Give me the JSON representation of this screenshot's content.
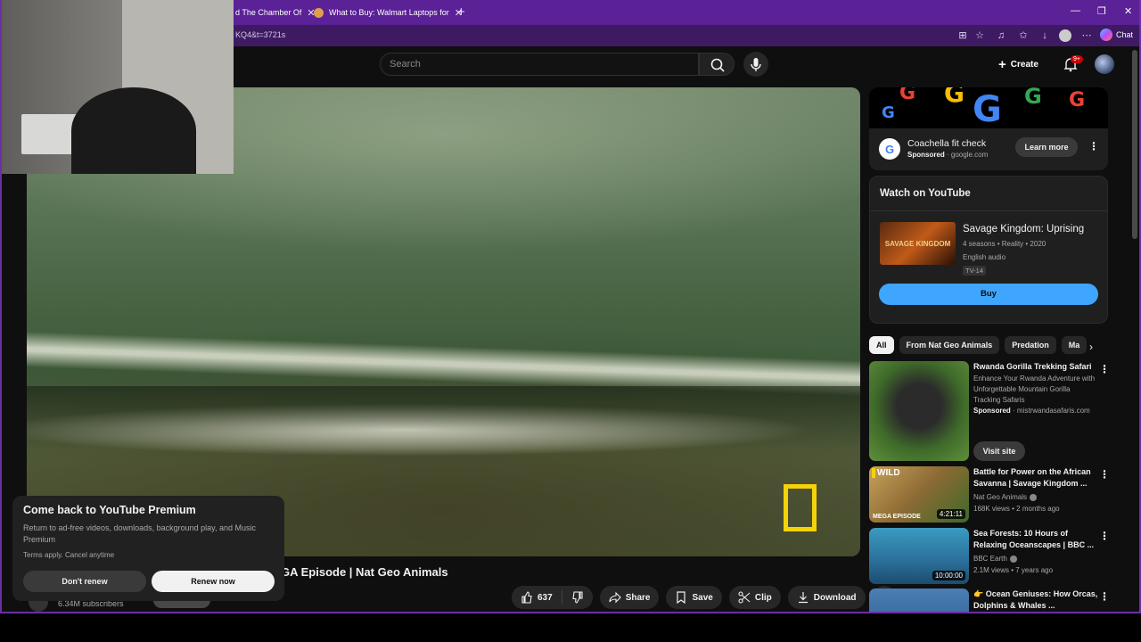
{
  "browser": {
    "tabs": [
      {
        "title": "d The Chamber Of"
      },
      {
        "title": "What to Buy: Walmart Laptops for"
      }
    ],
    "url": "KQ4&t=3721s",
    "chat_label": "Chat",
    "new_tab": "+"
  },
  "youtube": {
    "search_placeholder": "Search",
    "create_label": "Create",
    "notification_count": "9+"
  },
  "video": {
    "title_visible": "GA Episode | Nat Geo Animals",
    "subscribers": "6.34M subscribers",
    "likes": "637",
    "share_label": "Share",
    "save_label": "Save",
    "clip_label": "Clip",
    "download_label": "Download"
  },
  "premium_popup": {
    "title": "Come back to YouTube Premium",
    "description": "Return to ad-free videos, downloads, background play, and Music Premium",
    "terms": "Terms apply. Cancel anytime",
    "dont_renew": "Don't renew",
    "renew_now": "Renew now"
  },
  "ad": {
    "title": "Coachella fit check",
    "sponsored": "Sponsored",
    "domain": "google.com",
    "learn_more": "Learn more"
  },
  "watch_on_youtube": {
    "heading": "Watch on YouTube",
    "show_title": "Savage Kingdom: Uprising",
    "meta": "4 seasons • Reality • 2020",
    "audio": "English audio",
    "rating": "TV-14",
    "buy_label": "Buy",
    "poster_text": "SAVAGE KINGDOM"
  },
  "chips": [
    "All",
    "From Nat Geo Animals",
    "Predation",
    "Ma"
  ],
  "recommendations": [
    {
      "title": "Rwanda Gorilla Trekking Safari",
      "description": "Enhance Your Rwanda Adventure with Unforgettable Mountain Gorilla Tracking Safaris",
      "sponsored": "Sponsored",
      "domain": "mistrwandasafaris.com",
      "visit_site": "Visit site"
    },
    {
      "title": "Battle for Power on the African Savanna | Savage Kingdom ...",
      "channel": "Nat Geo Animals",
      "meta": "168K views • 2 months ago",
      "duration": "4:21:11",
      "thumb_badge": "WILD",
      "thumb_label": "MEGA EPISODE"
    },
    {
      "title": "Sea Forests: 10 Hours of Relaxing Oceanscapes | BBC ...",
      "channel": "BBC Earth",
      "meta": "2.1M views • 7 years ago",
      "duration": "10:00:00"
    },
    {
      "title": "👉 Ocean Geniuses: How Orcas, Dolphins & Whales ..."
    }
  ]
}
